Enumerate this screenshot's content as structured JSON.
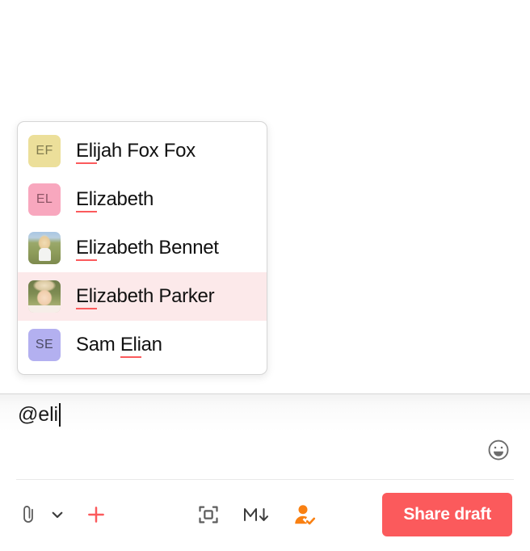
{
  "composer": {
    "input_value": "@eli",
    "emoji_icon": "smiley-face-icon",
    "toolbar": {
      "attachment_icon": "paperclip-icon",
      "attachment_dropdown_icon": "chevron-down-icon",
      "add_icon": "plus-icon",
      "snippet_icon": "scan-frame-icon",
      "markdown_icon": "markdown-icon",
      "markdown_label": "M↓",
      "recipient_icon": "person-check-icon",
      "share_draft_label": "Share draft"
    }
  },
  "mention_dropdown": {
    "query": "eli",
    "items": [
      {
        "name": "Elijah Fox Fox",
        "match_prefix": "Eli",
        "match_pre_text": "",
        "match_post_text": "jah Fox Fox",
        "avatar_type": "initials",
        "initials": "EF",
        "avatar_bg": "#ecdf9a",
        "avatar_fg": "#817b4e",
        "selected": false
      },
      {
        "name": "Elizabeth",
        "match_prefix": "Eli",
        "match_pre_text": "",
        "match_post_text": "zabeth",
        "avatar_type": "initials",
        "initials": "EL",
        "avatar_bg": "#f8a7be",
        "avatar_fg": "#8d5566",
        "selected": false
      },
      {
        "name": "Elizabeth Bennet",
        "match_prefix": "Eli",
        "match_pre_text": "",
        "match_post_text": "zabeth Bennet",
        "avatar_type": "photo",
        "photo_style": "photo-a",
        "selected": false
      },
      {
        "name": "Elizabeth Parker",
        "match_prefix": "Eli",
        "match_pre_text": "",
        "match_post_text": "zabeth Parker",
        "avatar_type": "photo",
        "photo_style": "photo-b",
        "selected": true
      },
      {
        "name": "Sam Elian",
        "match_prefix": "Eli",
        "match_pre_text": "Sam ",
        "match_post_text": "an",
        "avatar_type": "initials",
        "initials": "SE",
        "avatar_bg": "#b3b0f0",
        "avatar_fg": "#4b4a63",
        "selected": false
      }
    ]
  },
  "colors": {
    "accent": "#fb5a5c",
    "selected_row_bg": "#fce9ea",
    "recipient_icon": "#f98012"
  }
}
